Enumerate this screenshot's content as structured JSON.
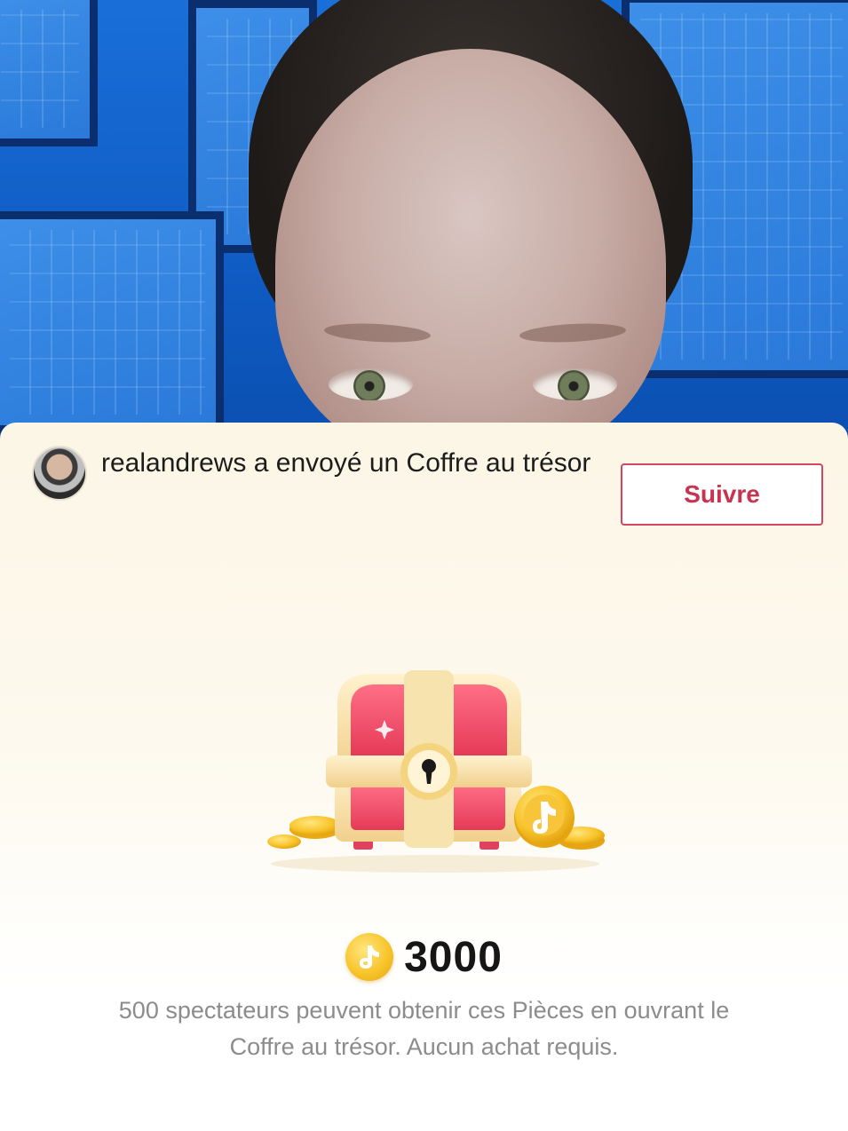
{
  "notification": {
    "text": "realandrews a envoyé un Coffre au trésor",
    "follow_label": "Suivre"
  },
  "reward": {
    "coin_icon": "tiktok-coin-icon",
    "amount": "3000",
    "description": "500 spectateurs peuvent obtenir ces Pièces en ouvrant le Coffre au trésor. Aucun achat requis."
  },
  "colors": {
    "accent": "#c8334f",
    "coin": "#f8c52c",
    "panel_bg": "#fcf6e6",
    "video_bg": "#1a6fd8"
  }
}
